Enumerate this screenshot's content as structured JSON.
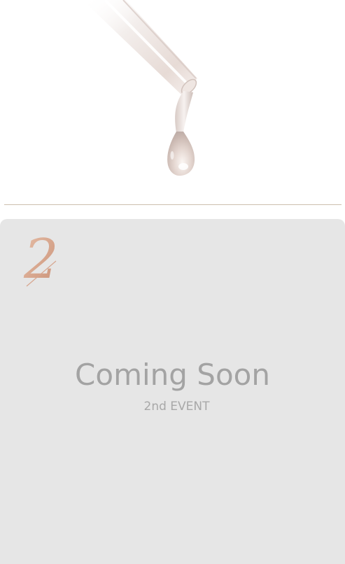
{
  "hero": {
    "image": "serum-dropper-icon",
    "accent_color": "#e9dcd6"
  },
  "divider_color": "#cdbfae",
  "event_card": {
    "background_color": "#e6e6e6",
    "number": "2",
    "number_color": "#d7a58e",
    "title": "Coming Soon",
    "subtitle": "2nd EVENT",
    "text_color": "#a3a3a3"
  }
}
